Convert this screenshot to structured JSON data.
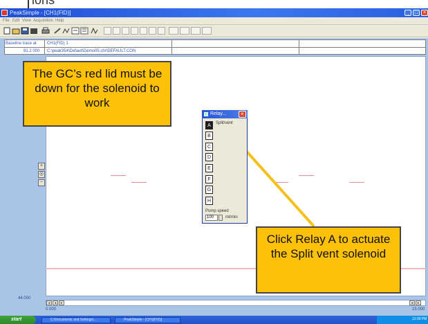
{
  "page_fragment": "ions",
  "window": {
    "title": "PeakSimple - [CH1(FID)]",
    "menu": [
      "File",
      "Edit",
      "View",
      "Acquisition",
      "Help"
    ],
    "controls": {
      "minimize": "_",
      "maximize": "□",
      "close": "×"
    }
  },
  "info": {
    "label1": "Baseline trace at",
    "value1": "CH1(FID) 1",
    "label2": "91.2 000",
    "value2": "C:\\peak354\\Default\\Demo05.chr\\DEFAULT.CON"
  },
  "axis": {
    "y_top": "91.2 000",
    "y_bottom": "44.000",
    "x_left": "0.000",
    "x_right": "15.000"
  },
  "side_tools": [
    "zoom-in",
    "zoom-fit",
    "zoom-out"
  ],
  "relay": {
    "title": "Relay...",
    "close": "×",
    "buttons": [
      "A",
      "B",
      "C",
      "D",
      "E",
      "F",
      "G",
      "H"
    ],
    "active": "A",
    "label_a": "Split/vent",
    "flow_label": "Pump speed",
    "flow_value": "100",
    "flow_unit": "ml/min"
  },
  "callouts": {
    "top": "The GC’s red lid must be down for the solenoid to work",
    "bottom": "Click Relay A to actuate the Split vent solenoid",
    "color": "#fdc108"
  },
  "taskbar": {
    "start": "start",
    "tasks": [
      "C:\\Documents and Settings\\...",
      "PeakSimple - [CH1(FID)]"
    ],
    "clock": "12:00 PM"
  },
  "colors": {
    "titlebar": "#2a5fe0",
    "app_background": "#a9c4e6",
    "trace": "#e88b8b",
    "arrow": "#f4c01a"
  }
}
